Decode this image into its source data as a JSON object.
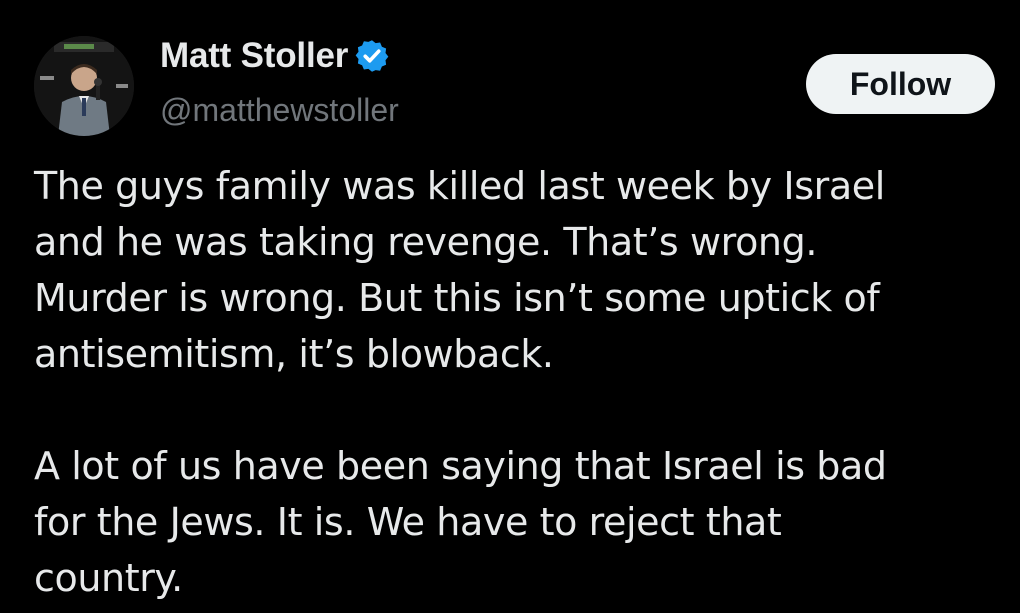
{
  "author": {
    "display_name": "Matt Stoller",
    "handle": "@matthewstoller",
    "verified": true,
    "avatar_icon": "profile-photo-icon"
  },
  "actions": {
    "follow_label": "Follow"
  },
  "tweet": {
    "paragraph1_lines": [
      "The guys family was killed last week by Israel",
      "and he was taking revenge. That’s wrong.",
      "Murder is wrong. But this isn’t some uptick of",
      "antisemitism, it’s blowback."
    ],
    "paragraph2_lines": [
      "A lot of us have been saying that Israel is bad",
      "for the Jews. It is. We have to reject that",
      "country."
    ]
  },
  "colors": {
    "background": "#000000",
    "text": "#e7e9ea",
    "secondary_text": "#71767b",
    "verified_badge": "#1d9bf0",
    "follow_button_bg": "#eff3f4",
    "follow_button_text": "#0f1419"
  }
}
